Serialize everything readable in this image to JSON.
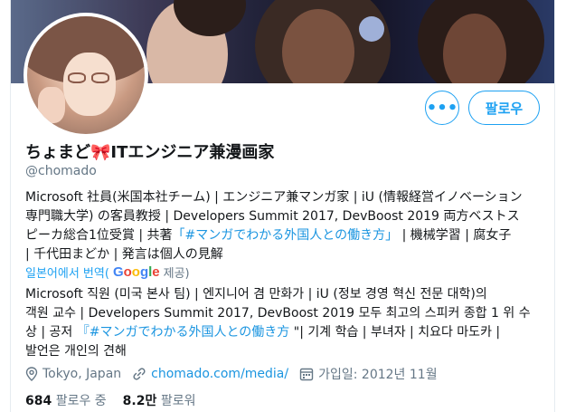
{
  "profile": {
    "display_name": "ちょまど🎀ITエンジニア兼漫画家",
    "handle": "@chomado",
    "follow_label": "팔로우",
    "more_label": "•••"
  },
  "bio": {
    "lines": [
      "Microsoft 社員(米国本社チーム) | エンジニア兼マンガ家 | iU (情報経営イノベーション",
      "専門職大学) の客員教授 | Developers Summit 2017, DevBoost 2019 両方ベストス",
      "ピーカ総合1位受賞 | 共著"
    ],
    "link_text": "「#マンガでわかる外国人との働き方」",
    "line3_tail": " | 機械学習 | 腐女子",
    "line4": "| 千代田まどか | 発言は個人の見解"
  },
  "translate": {
    "prefix": "일본어에서 번역(",
    "google": "Google",
    "suffix": " 제공)"
  },
  "translation": {
    "lines": [
      "Microsoft 직원 (미국 본사 팀) | 엔지니어 겸 만화가 | iU (정보 경영 혁신 전문 대학)의",
      "객원 교수 | Developers Summit 2017, DevBoost 2019 모두 최고의 스피커 종합 1 위 수",
      "상 | 공저 "
    ],
    "link_text": "『#マンガでわかる外国人との働き方 ",
    "line3_tail": "\"| 기계 학습 | 부녀자 | 치요다 마도카 |",
    "line4": "발언은 개인의 견해"
  },
  "meta": {
    "location": "Tokyo, Japan",
    "website": "chomado.com/media/",
    "joined": "가입일: 2012년 11월"
  },
  "stats": {
    "following_count": "684",
    "following_label": "팔로우 중",
    "followers_count": "8.2만",
    "followers_label": "팔로워"
  },
  "colors": {
    "accent": "#1da1f2",
    "link": "#1b95e0",
    "muted": "#657786"
  },
  "icons": [
    "location-icon",
    "link-icon",
    "calendar-icon",
    "more-icon"
  ]
}
